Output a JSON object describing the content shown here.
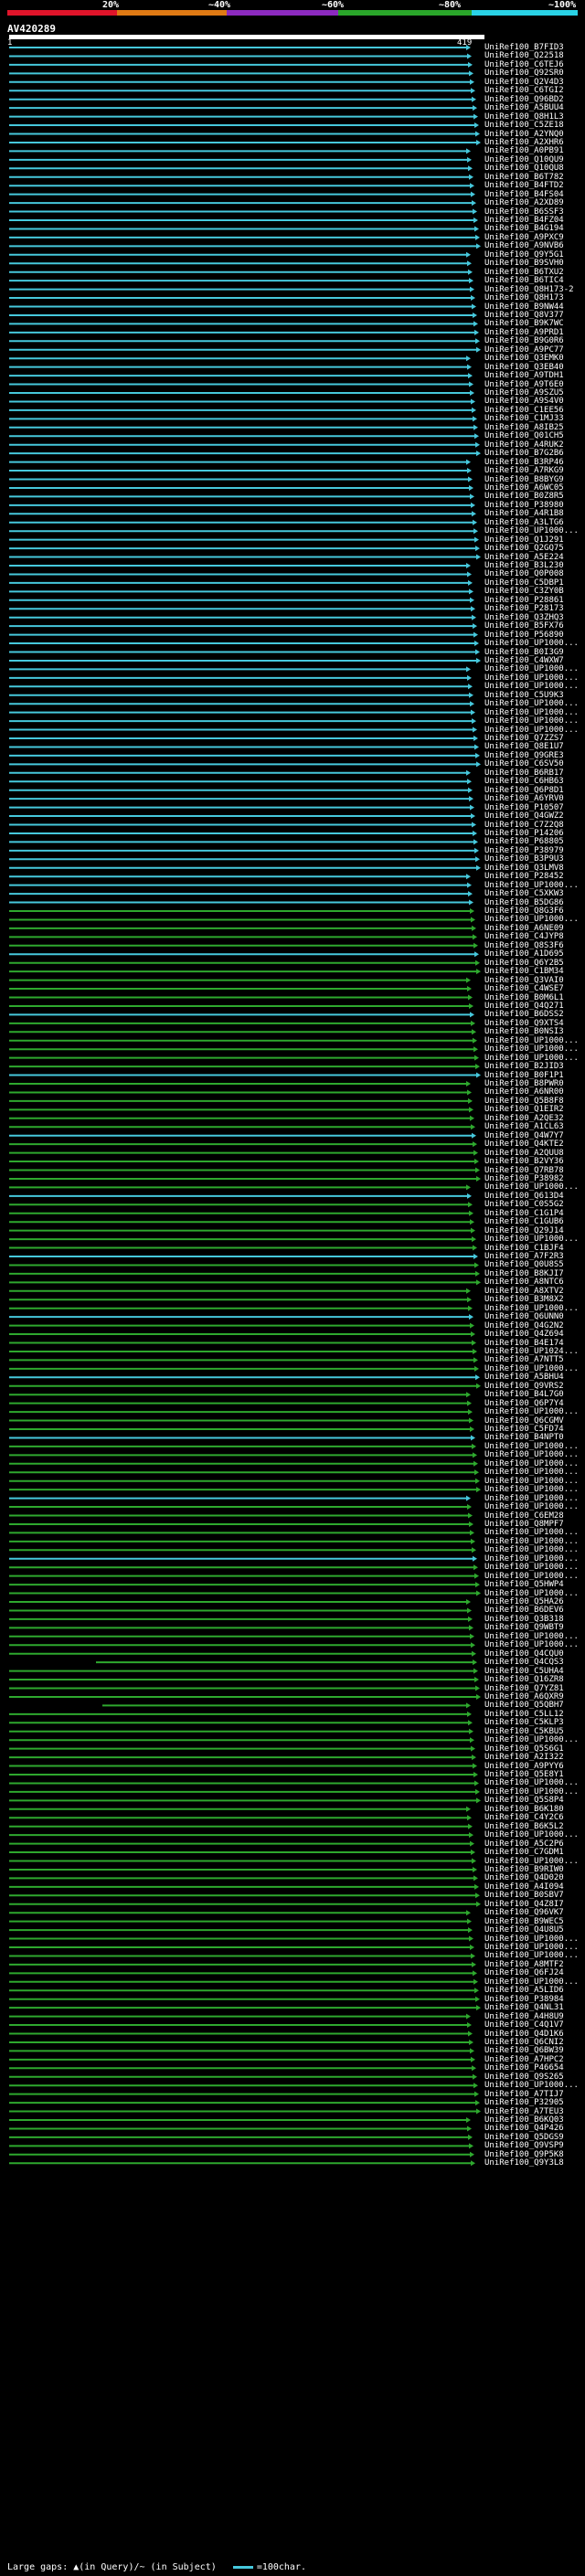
{
  "scale": {
    "labels": [
      "20%",
      "~40%",
      "~60%",
      "~80%",
      "~100%"
    ],
    "colors": [
      "#e0142a",
      "#e07a14",
      "#8c2abf",
      "#2aa62a",
      "#2ad2e6"
    ]
  },
  "query": {
    "id": "AV420289",
    "start": "1",
    "end": "419"
  },
  "hits": [
    "UniRef100_B7FID3",
    "UniRef100_Q22518",
    "UniRef100_C6TEJ6",
    "UniRef100_Q92SR0",
    "UniRef100_Q2V4D3",
    "UniRef100_C6TGI2",
    "UniRef100_Q96BD2",
    "UniRef100_A5BUU4",
    "UniRef100_Q8H1L3",
    "UniRef100_C5ZE18",
    "UniRef100_A2YNQ0",
    "UniRef100_A2XHR6",
    "UniRef100_A0PB91",
    "UniRef100_Q10QU9",
    "UniRef100_Q10QU8",
    "UniRef100_B6T782",
    "UniRef100_B4FTD2",
    "UniRef100_B4FS04",
    "UniRef100_A2XD89",
    "UniRef100_B6SSF3",
    "UniRef100_B4FZ04",
    "UniRef100_B4G194",
    "UniRef100_A9PXC9",
    "UniRef100_A9NVB6",
    "UniRef100_Q9Y5G1",
    "UniRef100_B9SVH0",
    "UniRef100_B6TXU2",
    "UniRef100_B6TIC4",
    "UniRef100_Q8H173-2",
    "UniRef100_Q8H173",
    "UniRef100_B9NW44",
    "UniRef100_Q8V377",
    "UniRef100_B9K7WC",
    "UniRef100_A9PRD1",
    "UniRef100_B9G0R6",
    "UniRef100_A9PC77",
    "UniRef100_Q3EMK0",
    "UniRef100_Q3EB40",
    "UniRef100_A9TDH1",
    "UniRef100_A9T6E0",
    "UniRef100_A9SZU5",
    "UniRef100_A9S4V0",
    "UniRef100_C1EE56",
    "UniRef100_C1MJ33",
    "UniRef100_A8IB25",
    "UniRef100_Q01CH5",
    "UniRef100_A4RUK2",
    "UniRef100_B7G2B6",
    "UniRef100_B3RP46",
    "UniRef100_A7RKG9",
    "UniRef100_B8BYG9",
    "UniRef100_A6WC05",
    "UniRef100_B0Z8R5",
    "UniRef100_P38980",
    "UniRef100_A4R1B8",
    "UniRef100_A3LTG6",
    "UniRef100_UP1000...",
    "UniRef100_Q1J291",
    "UniRef100_Q2GQ75",
    "UniRef100_A5E224",
    "UniRef100_B3L230",
    "UniRef100_Q0P008",
    "UniRef100_C5DBP1",
    "UniRef100_C3ZY0B",
    "UniRef100_P28861",
    "UniRef100_P28173",
    "UniRef100_Q3ZHQ3",
    "UniRef100_B5FX76",
    "UniRef100_P56890",
    "UniRef100_UP1000...",
    "UniRef100_B0I3G9",
    "UniRef100_C4WXW7",
    "UniRef100_UP1000...",
    "UniRef100_UP1000...",
    "UniRef100_UP1000...",
    "UniRef100_C5U9K3",
    "UniRef100_UP1000...",
    "UniRef100_UP1000...",
    "UniRef100_UP1000...",
    "UniRef100_UP1000...",
    "UniRef100_Q7ZZS7",
    "UniRef100_Q8E1U7",
    "UniRef100_Q9GRE3",
    "UniRef100_C6SV50",
    "UniRef100_B6RB17",
    "UniRef100_C6HB63",
    "UniRef100_Q6P8D1",
    "UniRef100_A6YRV0",
    "UniRef100_P10507",
    "UniRef100_Q4GWZ2",
    "UniRef100_C7Z2Q8",
    "UniRef100_P14206",
    "UniRef100_P68805",
    "UniRef100_P38979",
    "UniRef100_B3P9U3",
    "UniRef100_Q3LMV8",
    "UniRef100_P28452",
    "UniRef100_UP1000...",
    "UniRef100_C5XKW3",
    "UniRef100_B5DG86",
    "UniRef100_Q8G3F6",
    "UniRef100_UP1000...",
    "UniRef100_A6NE09",
    "UniRef100_C4JYP8",
    "UniRef100_Q8S3F6",
    "UniRef100_A1D695",
    "UniRef100_Q6Y2B5",
    "UniRef100_C1BM34",
    "UniRef100_Q3VAI0",
    "UniRef100_C4WSE7",
    "UniRef100_B0M6L1",
    "UniRef100_Q4Q271",
    "UniRef100_B6DSS2",
    "UniRef100_Q9XTS4",
    "UniRef100_B0NSI3",
    "UniRef100_UP1000...",
    "UniRef100_UP1000...",
    "UniRef100_UP1000...",
    "UniRef100_B2JID3",
    "UniRef100_B0F1P1",
    "UniRef100_B8PWR0",
    "UniRef100_A6NR00",
    "UniRef100_Q5B8F8",
    "UniRef100_Q1EIR2",
    "UniRef100_A2QE32",
    "UniRef100_A1CL63",
    "UniRef100_Q4W7Y7",
    "UniRef100_Q4KTE2",
    "UniRef100_A2QUU8",
    "UniRef100_B2VY36",
    "UniRef100_Q7RB78",
    "UniRef100_P38982",
    "UniRef100_UP1000...",
    "UniRef100_Q613D4",
    "UniRef100_C0S5G2",
    "UniRef100_C1G1P4",
    "UniRef100_C1GUB6",
    "UniRef100_Q29J14",
    "UniRef100_UP1000...",
    "UniRef100_C1BJF4",
    "UniRef100_A7F2R3",
    "UniRef100_Q0U8S5",
    "UniRef100_B8KJI7",
    "UniRef100_A8NTC6",
    "UniRef100_A8XTV2",
    "UniRef100_B3M8X2",
    "UniRef100_UP1000...",
    "UniRef100_Q6UNN0",
    "UniRef100_Q4G2N2",
    "UniRef100_Q4Z694",
    "UniRef100_B4E174",
    "UniRef100_UP1024...",
    "UniRef100_A7NTT5",
    "UniRef100_UP1000...",
    "UniRef100_A5BHU4",
    "UniRef100_Q9VRS2",
    "UniRef100_B4L7G0",
    "UniRef100_Q6P7Y4",
    "UniRef100_UP1000...",
    "UniRef100_Q6CGMV",
    "UniRef100_C5FD74",
    "UniRef100_B4NPT0",
    "UniRef100_UP1000...",
    "UniRef100_UP1000...",
    "UniRef100_UP1000...",
    "UniRef100_UP1000...",
    "UniRef100_UP1000...",
    "UniRef100_UP1000...",
    "UniRef100_UP1000...",
    "UniRef100_UP1000...",
    "UniRef100_C6EM28",
    "UniRef100_Q8MPF7",
    "UniRef100_UP1000...",
    "UniRef100_UP1000...",
    "UniRef100_UP1000...",
    "UniRef100_UP1000...",
    "UniRef100_UP1000...",
    "UniRef100_UP1000...",
    "UniRef100_Q5HWP4",
    "UniRef100_UP1000...",
    "UniRef100_Q5HA26",
    "UniRef100_B6DEV6",
    "UniRef100_Q3B318",
    "UniRef100_Q9WBT9",
    "UniRef100_UP1000...",
    "UniRef100_UP1000...",
    "UniRef100_Q4CQU0",
    "UniRef100_Q4CQS3",
    "UniRef100_C5UHA4",
    "UniRef100_Q16ZR8",
    "UniRef100_Q7YZ81",
    "UniRef100_A6QXR9",
    "UniRef100_Q5QBH7",
    "UniRef100_C5LL12",
    "UniRef100_C5KLP3",
    "UniRef100_C5KBU5",
    "UniRef100_UP1000...",
    "UniRef100_Q5S6G1",
    "UniRef100_A2I322",
    "UniRef100_A9PYY6",
    "UniRef100_Q5E8Y1",
    "UniRef100_UP1000...",
    "UniRef100_UP1000...",
    "UniRef100_Q5S8P4",
    "UniRef100_B6K180",
    "UniRef100_C4Y2C6",
    "UniRef100_B6K5L2",
    "UniRef100_UP1000...",
    "UniRef100_A5C2P6",
    "UniRef100_C7GDM1",
    "UniRef100_UP1000...",
    "UniRef100_B9RIW0",
    "UniRef100_Q4D020",
    "UniRef100_A4I094",
    "UniRef100_B0SBV7",
    "UniRef100_Q4Z8I7",
    "UniRef100_Q96VK7",
    "UniRef100_B9WEC5",
    "UniRef100_Q4U8U5",
    "UniRef100_UP1000...",
    "UniRef100_UP1000...",
    "UniRef100_UP1000...",
    "UniRef100_A8MTF2",
    "UniRef100_Q6FJ24",
    "UniRef100_UP1000...",
    "UniRef100_A5LID6",
    "UniRef100_P38984",
    "UniRef100_Q4NL31",
    "UniRef100_A4H8U9",
    "UniRef100_C4Q1V7",
    "UniRef100_Q4D1K6",
    "UniRef100_Q6CNI2",
    "UniRef100_Q6BW39",
    "UniRef100_A7HPC2",
    "UniRef100_P46654",
    "UniRef100_Q9S265",
    "UniRef100_UP1000...",
    "UniRef100_A7TIJ7",
    "UniRef100_P32905",
    "UniRef100_A7TEU3",
    "UniRef100_B6KQ03",
    "UniRef100_Q4P426",
    "UniRef100_Q5DGS9",
    "UniRef100_Q9VSP9",
    "UniRef100_Q9P5K8",
    "UniRef100_Q9Y3L8"
  ],
  "footer": {
    "large_gaps_text": "Large gaps: ▲(in Query)/~ (in Subject)",
    "legend_text": "=100char."
  }
}
